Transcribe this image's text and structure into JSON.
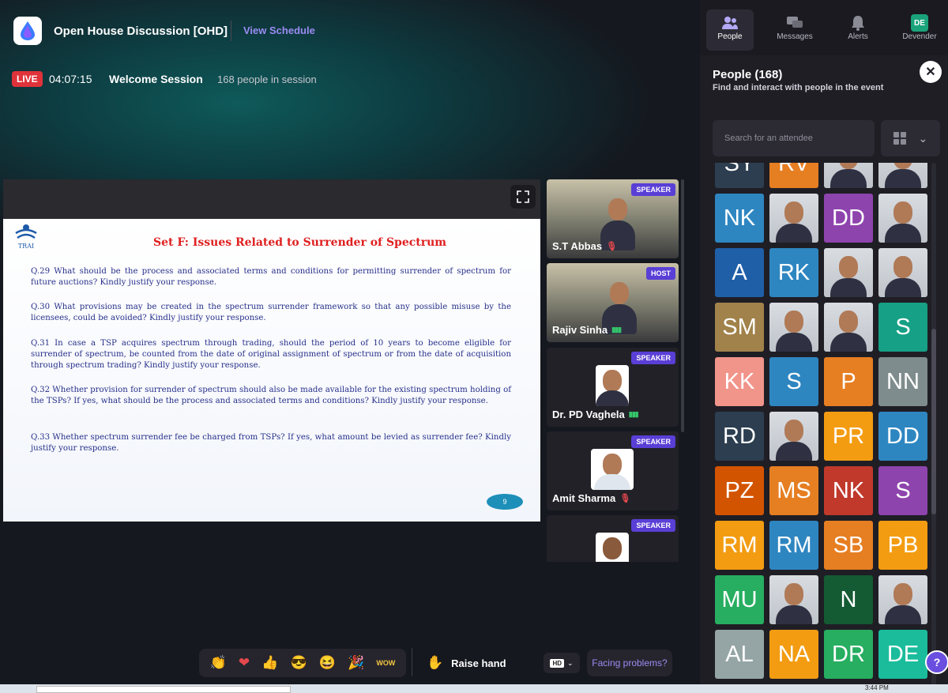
{
  "header": {
    "event_title": "Open House Discussion [OHD]",
    "view_schedule": "View Schedule"
  },
  "session": {
    "live": "LIVE",
    "timer": "04:07:15",
    "name": "Welcome Session",
    "people": "168 people in session"
  },
  "slide": {
    "logo_text": "TRAI",
    "title": "Set F: Issues Related to Surrender of Spectrum",
    "questions": [
      "Q.29 What should be the process and associated terms and conditions for permitting surrender of spectrum for future auctions? Kindly justify your response.",
      "Q.30 What provisions may be created in the spectrum surrender framework so that any possible misuse by the licensees, could be avoided? Kindly justify your response.",
      "Q.31 In case a TSP acquires spectrum through trading, should the period of 10 years to become eligible for surrender of spectrum, be counted from the date of original assignment of spectrum or from the date of acquisition through spectrum trading? Kindly justify your response.",
      "Q.32 Whether provision for surrender of spectrum should also be made available for the existing spectrum holding of the TSPs? If yes, what should be the process and associated terms and conditions? Kindly justify your response.",
      "Q.33 Whether spectrum surrender fee be charged from TSPs? If yes, what amount be levied as surrender fee? Kindly justify your response."
    ],
    "page": "9"
  },
  "speakers": [
    {
      "name": "S.T Abbas",
      "role": "SPEAKER",
      "mic": "off"
    },
    {
      "name": "Rajiv Sinha",
      "role": "HOST",
      "mic": "on"
    },
    {
      "name": "Dr. PD Vaghela",
      "role": "SPEAKER",
      "mic": "on"
    },
    {
      "name": "Amit Sharma",
      "role": "SPEAKER",
      "mic": "off"
    },
    {
      "name": "",
      "role": "SPEAKER",
      "mic": ""
    }
  ],
  "controls": {
    "raise_hand": "Raise hand",
    "quality": "HD",
    "facing_problems": "Facing problems?"
  },
  "reactions": [
    "clap",
    "heart",
    "thumbs-up",
    "cool",
    "laugh",
    "party",
    "wow"
  ],
  "rail": {
    "tabs": [
      {
        "label": "People",
        "icon": "people-icon"
      },
      {
        "label": "Messages",
        "icon": "messages-icon"
      },
      {
        "label": "Alerts",
        "icon": "bell-icon"
      },
      {
        "label": "Devender",
        "icon": "DE"
      }
    ],
    "title": "People (168)",
    "subtitle": "Find and interact with people in the event",
    "search_placeholder": "Search for an attendee",
    "attendees": [
      {
        "initials": "SY",
        "color": "#2c3e50"
      },
      {
        "initials": "RV",
        "color": "#e67e22"
      },
      {
        "initials": "",
        "color": "photo"
      },
      {
        "initials": "",
        "color": "photo"
      },
      {
        "initials": "NK",
        "color": "#2e86c1"
      },
      {
        "initials": "",
        "color": "photo"
      },
      {
        "initials": "DD",
        "color": "#8e44ad"
      },
      {
        "initials": "",
        "color": "photo"
      },
      {
        "initials": "A",
        "color": "#1f5fa8"
      },
      {
        "initials": "RK",
        "color": "#2e86c1"
      },
      {
        "initials": "",
        "color": "photo"
      },
      {
        "initials": "",
        "color": "photo"
      },
      {
        "initials": "SM",
        "color": "#a1824a"
      },
      {
        "initials": "",
        "color": "photo"
      },
      {
        "initials": "",
        "color": "photo"
      },
      {
        "initials": "S",
        "color": "#16a085"
      },
      {
        "initials": "KK",
        "color": "#f1948a"
      },
      {
        "initials": "S",
        "color": "#2e86c1"
      },
      {
        "initials": "P",
        "color": "#e67e22"
      },
      {
        "initials": "NN",
        "color": "#7f8c8d"
      },
      {
        "initials": "RD",
        "color": "#2c3e50"
      },
      {
        "initials": "",
        "color": "photo"
      },
      {
        "initials": "PR",
        "color": "#f39c12"
      },
      {
        "initials": "DD",
        "color": "#2e86c1"
      },
      {
        "initials": "PZ",
        "color": "#d35400"
      },
      {
        "initials": "MS",
        "color": "#e67e22"
      },
      {
        "initials": "NK",
        "color": "#c0392b"
      },
      {
        "initials": "S",
        "color": "#8e44ad"
      },
      {
        "initials": "RM",
        "color": "#f39c12"
      },
      {
        "initials": "RM",
        "color": "#2e86c1"
      },
      {
        "initials": "SB",
        "color": "#e67e22"
      },
      {
        "initials": "PB",
        "color": "#f39c12"
      },
      {
        "initials": "MU",
        "color": "#27ae60"
      },
      {
        "initials": "",
        "color": "photo"
      },
      {
        "initials": "N",
        "color": "#145a32"
      },
      {
        "initials": "",
        "color": "photo"
      },
      {
        "initials": "AL",
        "color": "#95a5a6"
      },
      {
        "initials": "NA",
        "color": "#f39c12"
      },
      {
        "initials": "DR",
        "color": "#27ae60"
      },
      {
        "initials": "DE",
        "color": "#1abc9c"
      }
    ]
  },
  "taskbar": {
    "time": "3:44 PM"
  }
}
